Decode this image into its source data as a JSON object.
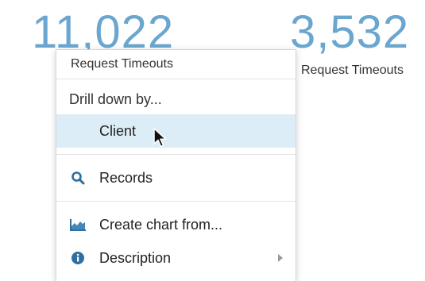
{
  "metrics": {
    "left_value": "11,022",
    "right_value": "3,532",
    "right_label": "Request Timeouts"
  },
  "context_menu": {
    "header": "Request Timeouts",
    "drill_down_label": "Drill down by...",
    "drill_down_items": [
      {
        "label": "Client",
        "highlighted": true
      }
    ],
    "actions": [
      {
        "label": "Records",
        "icon": "search-icon"
      },
      {
        "label": "Create chart from...",
        "icon": "area-chart-icon"
      },
      {
        "label": "Description",
        "icon": "info-icon",
        "has_submenu": true
      }
    ]
  },
  "colors": {
    "metric_value": "#6ba6cf",
    "highlight_bg": "#dcedf8",
    "icon_blue": "#2f6f9f"
  }
}
